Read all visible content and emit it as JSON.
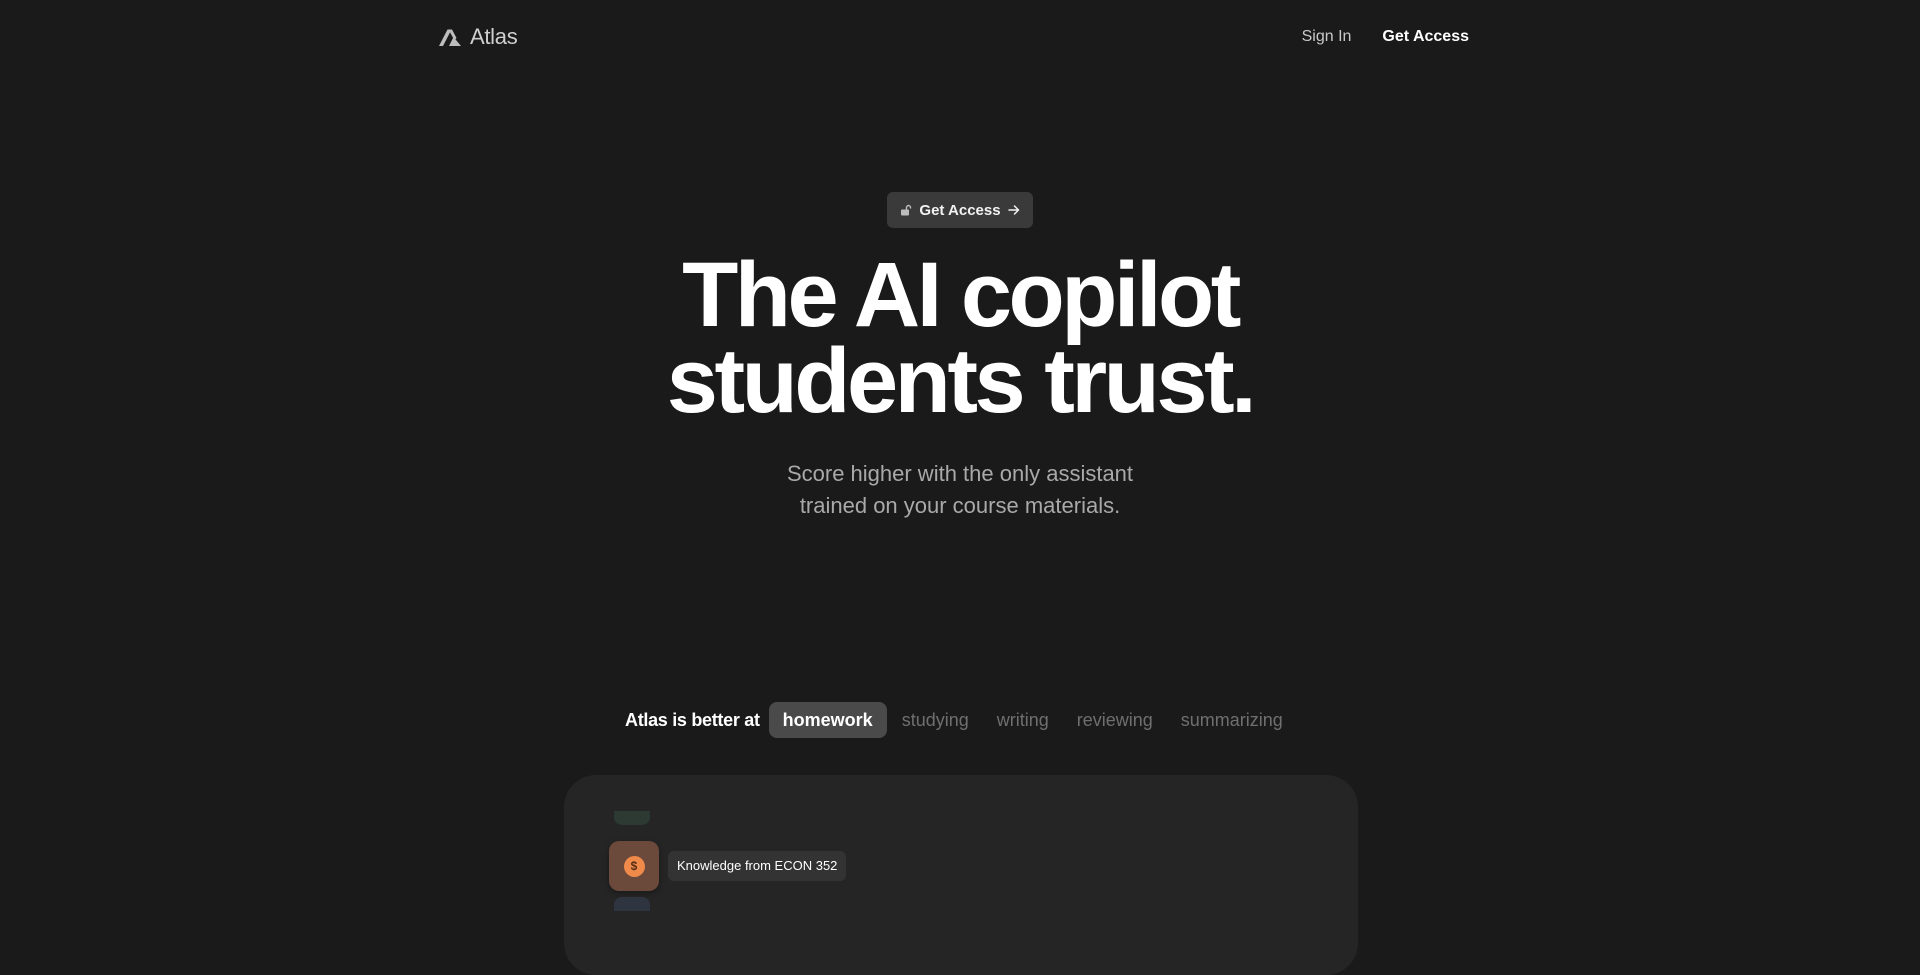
{
  "header": {
    "brand": "Atlas",
    "logo_icon": "atlas-logo-icon",
    "nav": {
      "sign_in": "Sign In",
      "get_access": "Get Access"
    }
  },
  "hero": {
    "pill": {
      "label": "Get Access",
      "left_icon": "unlock-icon",
      "right_icon": "arrow-right-icon"
    },
    "headline_line1": "The AI copilot",
    "headline_line2": "students trust.",
    "subhead_line1": "Score higher with the only assistant",
    "subhead_line2": "trained on your course materials."
  },
  "features": {
    "lead": "Atlas is better at",
    "tabs": [
      {
        "label": "homework",
        "active": true
      },
      {
        "label": "studying",
        "active": false
      },
      {
        "label": "writing",
        "active": false
      },
      {
        "label": "reviewing",
        "active": false
      },
      {
        "label": "summarizing",
        "active": false
      }
    ]
  },
  "demo_card": {
    "coin_icon": "dollar-coin-icon",
    "coin_symbol": "$",
    "tooltip": "Knowledge from ECON 352"
  },
  "colors": {
    "background": "#1a1a1a",
    "card": "#252525",
    "pill": "#3a3a3a",
    "active_tab": "#4a4a4a",
    "coin": "#f08a4b",
    "coin_tile": "#6b4a3c"
  }
}
